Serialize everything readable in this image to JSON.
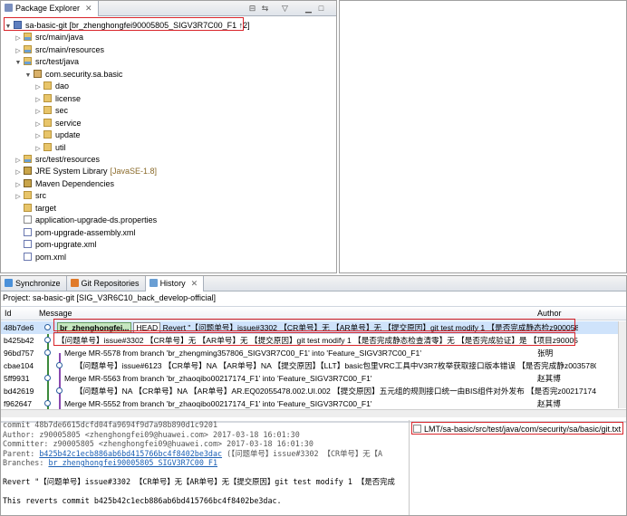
{
  "package_explorer": {
    "tab_label": "Package Explorer",
    "tree": [
      {
        "label": "sa-basic-git [br_zhenghongfei90005805_SIGV3R7C00_F1 ↑2]",
        "icon": "project-icon",
        "level": 0,
        "twisty": "▼"
      },
      {
        "label": "src/main/java",
        "icon": "source-folder-icon",
        "level": 1,
        "twisty": "▷"
      },
      {
        "label": "src/main/resources",
        "icon": "source-folder-icon",
        "level": 1,
        "twisty": "▷"
      },
      {
        "label": "src/test/java",
        "icon": "source-folder-icon",
        "level": 1,
        "twisty": "▼"
      },
      {
        "label": "com.security.sa.basic",
        "icon": "package-icon",
        "level": 2,
        "twisty": "▼"
      },
      {
        "label": "dao",
        "icon": "folder-icon",
        "level": 3,
        "twisty": "▷"
      },
      {
        "label": "license",
        "icon": "folder-icon",
        "level": 3,
        "twisty": "▷"
      },
      {
        "label": "sec",
        "icon": "folder-icon",
        "level": 3,
        "twisty": "▷"
      },
      {
        "label": "service",
        "icon": "folder-icon",
        "level": 3,
        "twisty": "▷"
      },
      {
        "label": "update",
        "icon": "folder-icon",
        "level": 3,
        "twisty": "▷"
      },
      {
        "label": "util",
        "icon": "folder-icon",
        "level": 3,
        "twisty": "▷"
      },
      {
        "label": "src/test/resources",
        "icon": "source-folder-icon",
        "level": 1,
        "twisty": "▷"
      },
      {
        "label": "JRE System Library",
        "suffix": "[JavaSE-1.8]",
        "icon": "library-icon",
        "level": 1,
        "twisty": "▷"
      },
      {
        "label": "Maven Dependencies",
        "icon": "library-icon",
        "level": 1,
        "twisty": "▷"
      },
      {
        "label": "src",
        "icon": "folder-icon",
        "level": 1,
        "twisty": "▷"
      },
      {
        "label": "target",
        "icon": "folder-icon",
        "level": 1,
        "twisty": ""
      },
      {
        "label": "application-upgrade-ds.properties",
        "icon": "file-icon",
        "level": 1,
        "twisty": ""
      },
      {
        "label": "pom-upgrade-assembly.xml",
        "icon": "xml-file-icon",
        "level": 1,
        "twisty": ""
      },
      {
        "label": "pom-upgrate.xml",
        "icon": "xml-file-icon",
        "level": 1,
        "twisty": ""
      },
      {
        "label": "pom.xml",
        "icon": "xml-file-icon",
        "level": 1,
        "twisty": ""
      }
    ]
  },
  "bottom_tabs": [
    "Synchronize",
    "Git Repositories",
    "History"
  ],
  "history": {
    "project_line": "Project: sa-basic-git [SIG_V3R6C10_back_develop-official]",
    "columns": {
      "id": "Id",
      "message": "Message",
      "author": "Author"
    },
    "rows": [
      {
        "id": "48b7de6",
        "branch": "br_zhenghongfei...",
        "head": "HEAD",
        "message": "Revert \"【问题单号】issue#3302 【CR单号】无 【AR单号】无 【提交原因】git test modify 1 【是否完成静态检z90005805",
        "author": ""
      },
      {
        "id": "b425b42",
        "message": "【问题单号】issue#3302 【CR单号】无 【AR单号】无 【提交原因】git test modify 1 【是否完成静态检查清零】无 【是否完成验证】是 【项目z90005805",
        "author": ""
      },
      {
        "id": "96bd757",
        "message": "Merge MR-5578 from branch 'br_zhengming357806_SIGV3R7C00_F1' into 'Feature_SIGV3R7C00_F1'",
        "author": "张明"
      },
      {
        "id": "cbae104",
        "message": "【问题单号】issue#6123 【CR单号】NA 【AR单号】NA 【提交原因】【LLT】basic包里VRC工具中V3R7枚举获取接口版本错误 【是否完成静z00357806",
        "author": ""
      },
      {
        "id": "5ff9931",
        "message": "Merge MR-5563 from branch 'br_zhaoqibo00217174_F1' into 'Feature_SIGV3R7C00_F1'",
        "author": "赵其博"
      },
      {
        "id": "bd42619",
        "message": "【问题单号】NA 【CR单号】NA 【AR单号】AR.EQ02055478.002.UI.002 【提交原因】五元组的规则接口统一由BIS组件对外发布 【是否完z00217174",
        "author": ""
      },
      {
        "id": "f962647",
        "message": "Merge MR-5552 from branch 'br_zhaoqibo00217174_F1' into 'Feature_SIGV3R7C00_F1'",
        "author": "赵其博"
      }
    ]
  },
  "commit_detail": {
    "lines": [
      "commit 48b7de6615dcfd04fa9694f9d7a98b890d1c9201",
      "Author: z90005805 <zhenghongfei09@huawei.com> 2017-03-18 16:01:30",
      "Committer: z90005805 <zhenghongfei09@huawei.com> 2017-03-18 16:01:30"
    ],
    "parent_label": "Parent:",
    "parent_link": "b425b42c1ecb886ab6bd415766bc4f8402be3dac",
    "parent_rest": "(【问题单号】issue#3302 【CR单号】无【A",
    "branches_label": "Branches:",
    "branches_link": "br_zhenghongfei90005805_SIGV3R7C00_F1",
    "revert_line": "Revert \"【问题单号】issue#3302 【CR单号】无【AR单号】无【提交原因】git test modify 1 【是否完成",
    "reverts_line": "This reverts commit b425b42c1ecb886ab6bd415766bc4f8402be3dac."
  },
  "changed_files": [
    "LMT/sa-basic/src/test/java/com/security/sa/basic/git.txt"
  ],
  "colors": {
    "highlight": "#d9252b",
    "branch_label": "#c6e7c0",
    "selection": "#cfe3fb",
    "link": "#1a5fb4"
  }
}
